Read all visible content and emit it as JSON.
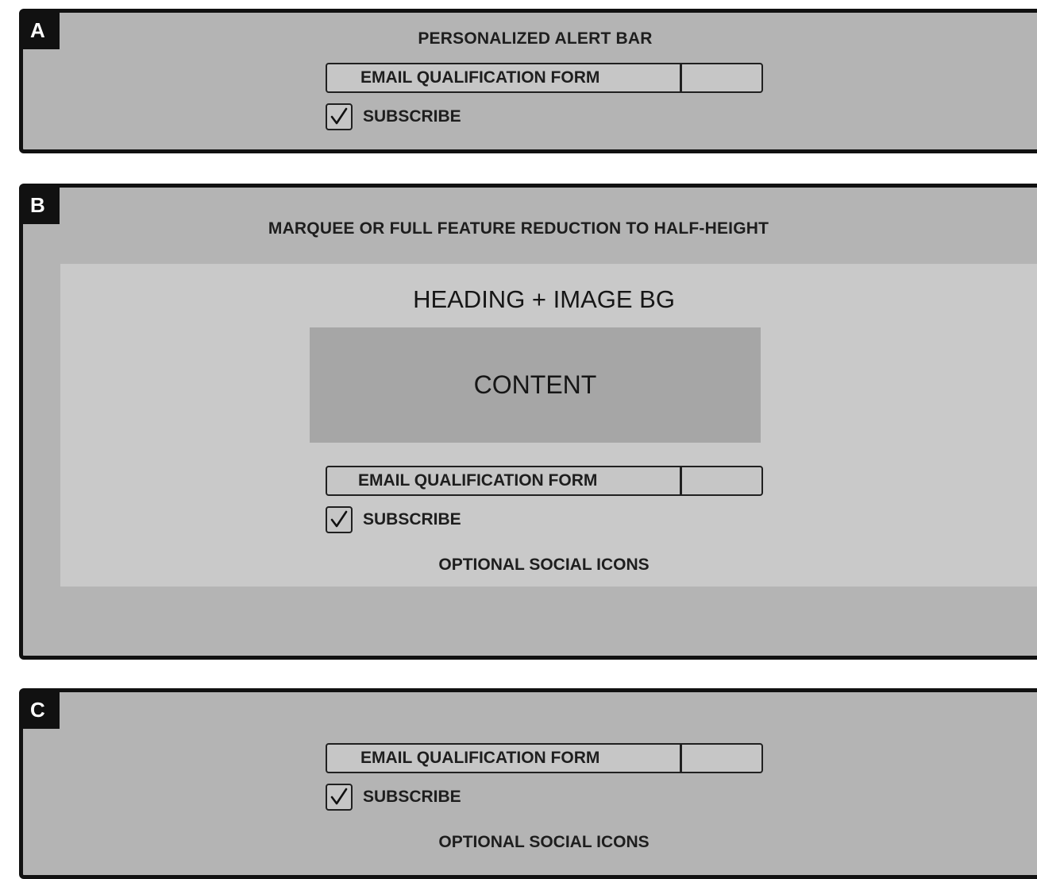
{
  "panels": {
    "a": {
      "label": "A",
      "title": "PERSONALIZED ALERT BAR",
      "email_form_label": "EMAIL QUALIFICATION FORM",
      "subscribe_label": "SUBSCRIBE",
      "subscribe_checked": true
    },
    "b": {
      "label": "B",
      "title": "MARQUEE OR FULL FEATURE REDUCTION TO HALF-HEIGHT",
      "heading": "HEADING + IMAGE BG",
      "content_label": "CONTENT",
      "email_form_label": "EMAIL QUALIFICATION FORM",
      "subscribe_label": "SUBSCRIBE",
      "subscribe_checked": true,
      "social_label": "OPTIONAL SOCIAL ICONS"
    },
    "c": {
      "label": "C",
      "email_form_label": "EMAIL QUALIFICATION FORM",
      "subscribe_label": "SUBSCRIBE",
      "subscribe_checked": true,
      "social_label": "OPTIONAL SOCIAL ICONS"
    }
  },
  "colors": {
    "panel_bg": "#b4b4b4",
    "inner_bg": "#c9c9c9",
    "content_bg": "#a6a6a6",
    "border": "#111111"
  }
}
